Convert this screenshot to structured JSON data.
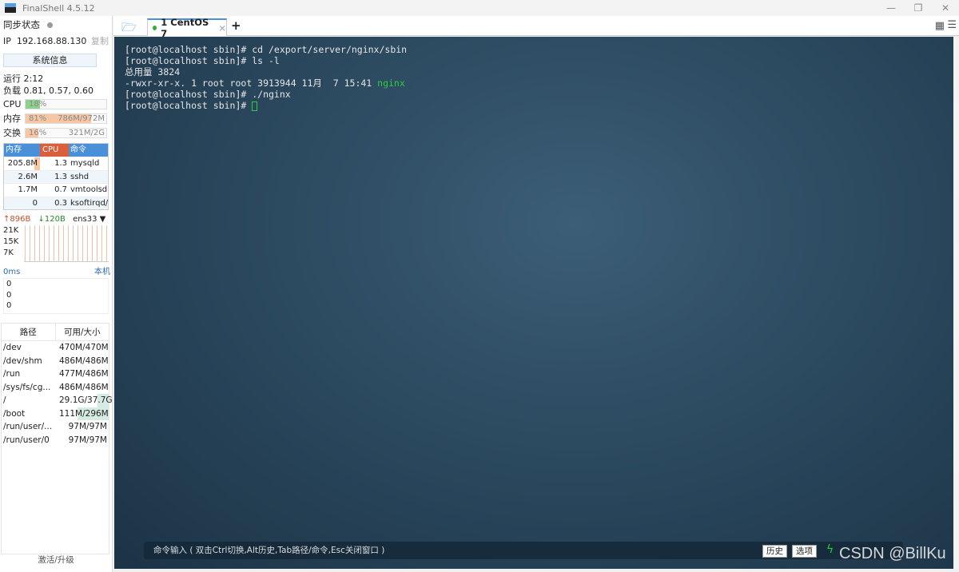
{
  "window": {
    "title": "FinalShell 4.5.12",
    "minimize": "—",
    "maximize": "❐",
    "close": "✕"
  },
  "sidebar": {
    "sync_label": "同步状态",
    "ip_label": "IP",
    "ip": "192.168.88.130",
    "copy": "复制",
    "sysinfo": "系统信息",
    "uptime": "运行 2:12",
    "load": "负载 0.81, 0.57, 0.60",
    "cpu": {
      "label": "CPU",
      "pct": "18%",
      "value": 18
    },
    "mem": {
      "label": "内存",
      "pct": "81%",
      "detail": "786M/972M",
      "value": 81
    },
    "swap": {
      "label": "交换",
      "pct": "16%",
      "detail": "321M/2G",
      "value": 16
    },
    "proc_headers": [
      "内存",
      "CPU",
      "命令"
    ],
    "processes": [
      [
        "205.8M",
        "1.3",
        "mysqld"
      ],
      [
        "2.6M",
        "1.3",
        "sshd"
      ],
      [
        "1.7M",
        "0.7",
        "vmtoolsd"
      ],
      [
        "0",
        "0.3",
        "ksoftirqd/0"
      ]
    ],
    "net": {
      "up": "896B",
      "down": "120B",
      "iface": "ens33",
      "ticks": [
        "21K",
        "15K",
        "7K"
      ]
    },
    "ping": {
      "latency": "0ms",
      "host": "本机",
      "vals": [
        "0",
        "0",
        "0"
      ]
    },
    "disk_headers": [
      "路径",
      "可用/大小"
    ],
    "disks": [
      [
        "/dev",
        "470M/470M"
      ],
      [
        "/dev/shm",
        "486M/486M"
      ],
      [
        "/run",
        "477M/486M"
      ],
      [
        "/sys/fs/cg...",
        "486M/486M"
      ],
      [
        "/",
        "29.1G/37.7G"
      ],
      [
        "/boot",
        "111M/296M"
      ],
      [
        "/run/user/...",
        "97M/97M"
      ],
      [
        "/run/user/0",
        "97M/97M"
      ]
    ],
    "activate": "激活/升级"
  },
  "tabs": [
    {
      "label": "1 CentOS 7",
      "close": "×"
    }
  ],
  "add_tab": "+",
  "terminal": {
    "lines": [
      "[root@localhost sbin]# cd /export/server/nginx/sbin",
      "[root@localhost sbin]# ls -l",
      "总用量 3824"
    ],
    "ls_line": "-rwxr-xr-x. 1 root root 3913944 11月  7 15:41 ",
    "ls_file": "nginx",
    "line5": "[root@localhost sbin]# ./nginx",
    "prompt": "[root@localhost sbin]# "
  },
  "cmdbar": {
    "placeholder": "命令输入 ( 双击Ctrl切换,Alt历史,Tab路径/命令,Esc关闭窗口 )",
    "history": "历史",
    "options": "选项"
  },
  "watermark": "CSDN @BillKu",
  "colors": {
    "accent": "#4a90d9",
    "cpu": "#8fd18f",
    "mem": "#f7c7a3",
    "ls_file": "#2ecc40"
  }
}
